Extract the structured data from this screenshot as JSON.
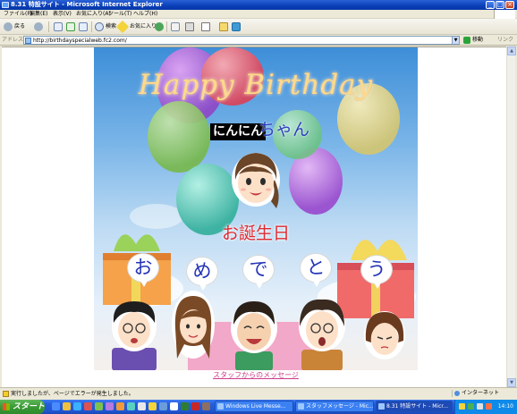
{
  "window": {
    "title": "8.31 特設サイト - Microsoft Internet Explorer",
    "controls": [
      "_",
      "□",
      "×"
    ]
  },
  "menu": [
    "ファイル(F)",
    "編集(E)",
    "表示(V)",
    "お気に入り(A)",
    "ツール(T)",
    "ヘルプ(H)"
  ],
  "toolbar": {
    "back": "戻る",
    "search": "検索",
    "favorites": "お気に入り"
  },
  "address": {
    "label": "アドレス(D)",
    "url": "http://birthdayspecialweb.fc2.com/",
    "go": "移動",
    "links": "リンク"
  },
  "card": {
    "title": "Happy Birthday",
    "name": "にんにん",
    "suffix": "ちゃん",
    "greeting": "お誕生日",
    "bubbles": [
      "お",
      "め",
      "で",
      "と",
      "う"
    ],
    "message_link": "スタッフからのメッセージ"
  },
  "status": {
    "text": "実行しましたが、ページでエラーが発生しました。",
    "zone": "インターネット"
  },
  "taskbar": {
    "start": "スタート",
    "tasks": [
      {
        "label": "Windows Live Messe...",
        "active": false
      },
      {
        "label": "スタッフメッセージ - Mic...",
        "active": false
      },
      {
        "label": "8.31 特設サイト - Micr...",
        "active": true
      }
    ],
    "clock": "14:10"
  },
  "colors": {
    "titlebar": "#0a3fb8",
    "chrome": "#ece9d8",
    "name_bg": "#000000",
    "chan": "#2b3fbd",
    "greeting": "#e0282f",
    "bubble_text": "#2333b8",
    "link": "#cc3b8a"
  }
}
